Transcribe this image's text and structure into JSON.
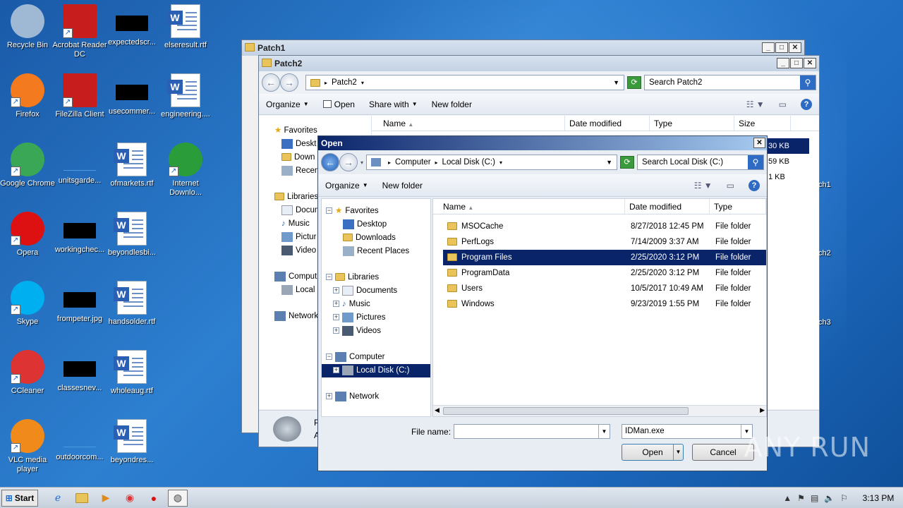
{
  "desktop_icons": [
    {
      "label": "Recycle Bin",
      "type": "recycle"
    },
    {
      "label": "Acrobat Reader DC",
      "type": "acrobat"
    },
    {
      "label": "expectedscr...",
      "type": "black"
    },
    {
      "label": "elseresult.rtf",
      "type": "doc"
    },
    {
      "label": "Firefox",
      "type": "firefox"
    },
    {
      "label": "FileZilla Client",
      "type": "filezilla"
    },
    {
      "label": "usecommer...",
      "type": "black"
    },
    {
      "label": "engineering....",
      "type": "doc"
    },
    {
      "label": "Google Chrome",
      "type": "chrome"
    },
    {
      "label": "unitsgarde...",
      "type": "blank"
    },
    {
      "label": "ofmarkets.rtf",
      "type": "doc"
    },
    {
      "label": "Internet Downlo...",
      "type": "idm"
    },
    {
      "label": "Opera",
      "type": "opera"
    },
    {
      "label": "workingchec...",
      "type": "black"
    },
    {
      "label": "beyondlesbi...",
      "type": "doc"
    },
    {
      "label": "Skype",
      "type": "skype"
    },
    {
      "label": "frompeter.jpg",
      "type": "black"
    },
    {
      "label": "handsolder.rtf",
      "type": "doc"
    },
    {
      "label": "CCleaner",
      "type": "ccleaner"
    },
    {
      "label": "classesnev...",
      "type": "black"
    },
    {
      "label": "wholeaug.rtf",
      "type": "doc"
    },
    {
      "label": "VLC media player",
      "type": "vlc"
    },
    {
      "label": "outdoorcom...",
      "type": "blank"
    },
    {
      "label": "beyondres..."
    }
  ],
  "patch1": {
    "title": "Patch1"
  },
  "patch2": {
    "title": "Patch2",
    "path": "Patch2",
    "search_placeholder": "Search Patch2",
    "toolbar": {
      "organize": "Organize",
      "open": "Open",
      "share": "Share with",
      "new_folder": "New folder"
    },
    "columns": {
      "name": "Name",
      "date": "Date modified",
      "type": "Type",
      "size": "Size"
    },
    "sizes": [
      "30 KB",
      "59 KB",
      "1 KB"
    ],
    "right_labels": [
      "ch1",
      "ch2",
      "ch3"
    ],
    "nav": {
      "favorites": "Favorites",
      "desktop": "Deskt",
      "downloads": "Down",
      "recent": "Recen",
      "libraries": "Libraries",
      "documents": "Docun",
      "music": "Music",
      "pictures": "Pictur",
      "videos": "Video",
      "computer": "Comput",
      "local": "Local",
      "network": "Network"
    },
    "details_a": "P",
    "details_b": "A"
  },
  "open_dialog": {
    "title": "Open",
    "breadcrumb": [
      "Computer",
      "Local Disk (C:)"
    ],
    "search_placeholder": "Search Local Disk (C:)",
    "toolbar": {
      "organize": "Organize",
      "new_folder": "New folder"
    },
    "columns": {
      "name": "Name",
      "date": "Date modified",
      "type": "Type"
    },
    "nav": {
      "favorites": "Favorites",
      "desktop": "Desktop",
      "downloads": "Downloads",
      "recent": "Recent Places",
      "libraries": "Libraries",
      "documents": "Documents",
      "music": "Music",
      "pictures": "Pictures",
      "videos": "Videos",
      "computer": "Computer",
      "local_disk": "Local Disk (C:)",
      "network": "Network"
    },
    "files": [
      {
        "name": "MSOCache",
        "date": "8/27/2018 12:45 PM",
        "type": "File folder",
        "locked": true
      },
      {
        "name": "PerfLogs",
        "date": "7/14/2009 3:37 AM",
        "type": "File folder"
      },
      {
        "name": "Program Files",
        "date": "2/25/2020 3:12 PM",
        "type": "File folder",
        "selected": true
      },
      {
        "name": "ProgramData",
        "date": "2/25/2020 3:12 PM",
        "type": "File folder"
      },
      {
        "name": "Users",
        "date": "10/5/2017 10:49 AM",
        "type": "File folder"
      },
      {
        "name": "Windows",
        "date": "9/23/2019 1:55 PM",
        "type": "File folder"
      }
    ],
    "filename_label": "File name:",
    "filename_value": "",
    "filter_value": "IDMan.exe",
    "open_label": "Open",
    "cancel_label": "Cancel"
  },
  "taskbar": {
    "start": "Start",
    "clock": "3:13 PM"
  },
  "watermark": "ANY RUN"
}
